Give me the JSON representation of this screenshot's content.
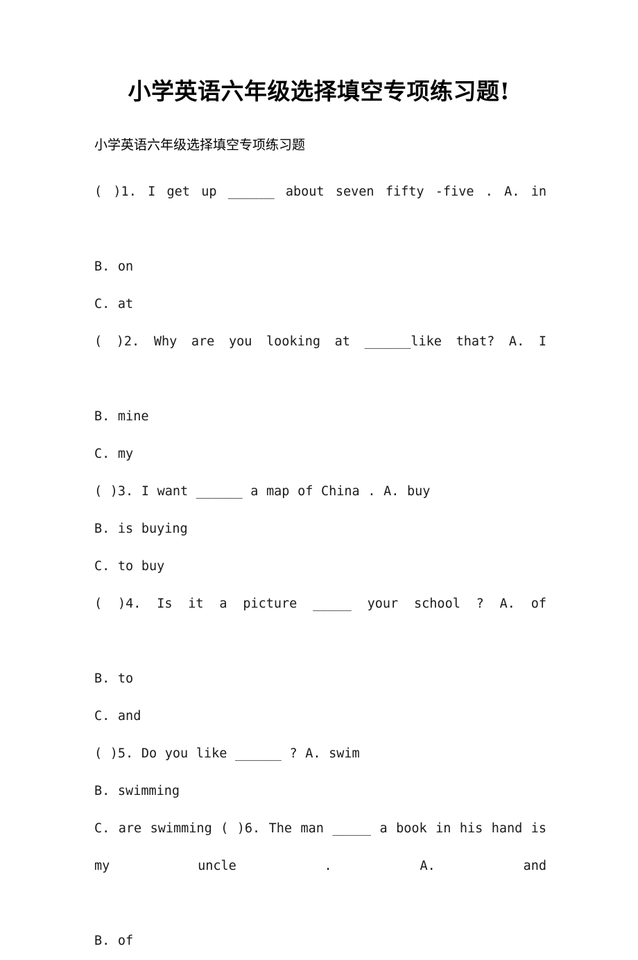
{
  "document": {
    "title": "小学英语六年级选择填空专项练习题!",
    "subtitle": "小学英语六年级选择填空专项练习题",
    "background_color": "#ffffff",
    "text_color": "#000000"
  },
  "paragraphs": [
    {
      "id": "q1",
      "text": "(    )1. I get up ______ about seven fifty -five .           A. in"
    },
    {
      "id": "q1b",
      "text": "B. on"
    },
    {
      "id": "q1c",
      "text": "C. at"
    },
    {
      "id": "q2",
      "text": "(    )2. Why are you looking at ______like that?          A. I"
    },
    {
      "id": "q2b",
      "text": "B. mine"
    },
    {
      "id": "q2c",
      "text": "C. my"
    },
    {
      "id": "q3",
      "text": "(    )3. I want ______ a map of China .         A. buy"
    },
    {
      "id": "q3b",
      "text": "B. is buying"
    },
    {
      "id": "q3c",
      "text": "C. to buy"
    },
    {
      "id": "q4",
      "text": "(    )4. Is it a picture _____ your school ?          A. of"
    },
    {
      "id": "q4b",
      "text": "B. to"
    },
    {
      "id": "q4c",
      "text": "C. and"
    },
    {
      "id": "q5",
      "text": "(    )5. Do you like ______ ?         A. swim"
    },
    {
      "id": "q5b",
      "text": "B. swimming"
    },
    {
      "id": "q6",
      "text": "C. are swimming (    )6. The man _____ a book in his hand is my uncle .        A. and"
    },
    {
      "id": "q6b",
      "text": "B. of"
    }
  ],
  "questions": [
    {
      "number": "1",
      "stem": "I get up ______ about seven fifty -five .",
      "options": [
        {
          "letter": "A.",
          "text": "in"
        },
        {
          "letter": "B.",
          "text": "on"
        },
        {
          "letter": "C.",
          "text": "at"
        }
      ]
    },
    {
      "number": "2",
      "stem": "Why are you looking at ______like that?",
      "options": [
        {
          "letter": "A.",
          "text": "I"
        },
        {
          "letter": "B.",
          "text": "mine"
        },
        {
          "letter": "C.",
          "text": "my"
        }
      ]
    },
    {
      "number": "3",
      "stem": "I want ______ a map of China .",
      "options": [
        {
          "letter": "A.",
          "text": "buy"
        },
        {
          "letter": "B.",
          "text": "is buying"
        },
        {
          "letter": "C.",
          "text": "to buy"
        }
      ]
    },
    {
      "number": "4",
      "stem": "Is it a picture _____ your school ?",
      "options": [
        {
          "letter": "A.",
          "text": "of"
        },
        {
          "letter": "B.",
          "text": "to"
        },
        {
          "letter": "C.",
          "text": "and"
        }
      ]
    },
    {
      "number": "5",
      "stem": "Do you like ______ ?",
      "options": [
        {
          "letter": "A.",
          "text": "swim"
        },
        {
          "letter": "B.",
          "text": "swimming"
        },
        {
          "letter": "C.",
          "text": "are swimming"
        }
      ]
    },
    {
      "number": "6",
      "stem": "The man _____ a book in his hand is my uncle .",
      "options": [
        {
          "letter": "A.",
          "text": "and"
        },
        {
          "letter": "B.",
          "text": "of"
        }
      ]
    }
  ]
}
